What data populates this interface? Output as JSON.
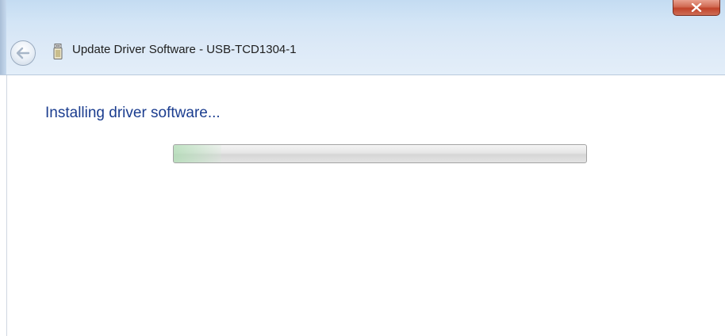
{
  "window": {
    "title": "Update Driver Software - USB-TCD1304-1"
  },
  "main": {
    "heading": "Installing driver software..."
  },
  "progress": {
    "fraction": 0.0,
    "indeterminate": true
  },
  "icons": {
    "back": "back-arrow-icon",
    "device": "usb-device-icon",
    "close": "close-icon"
  },
  "colors": {
    "heading": "#1b3d8f",
    "close_button": "#c1432a",
    "titlebar": "#d3e5f6"
  }
}
